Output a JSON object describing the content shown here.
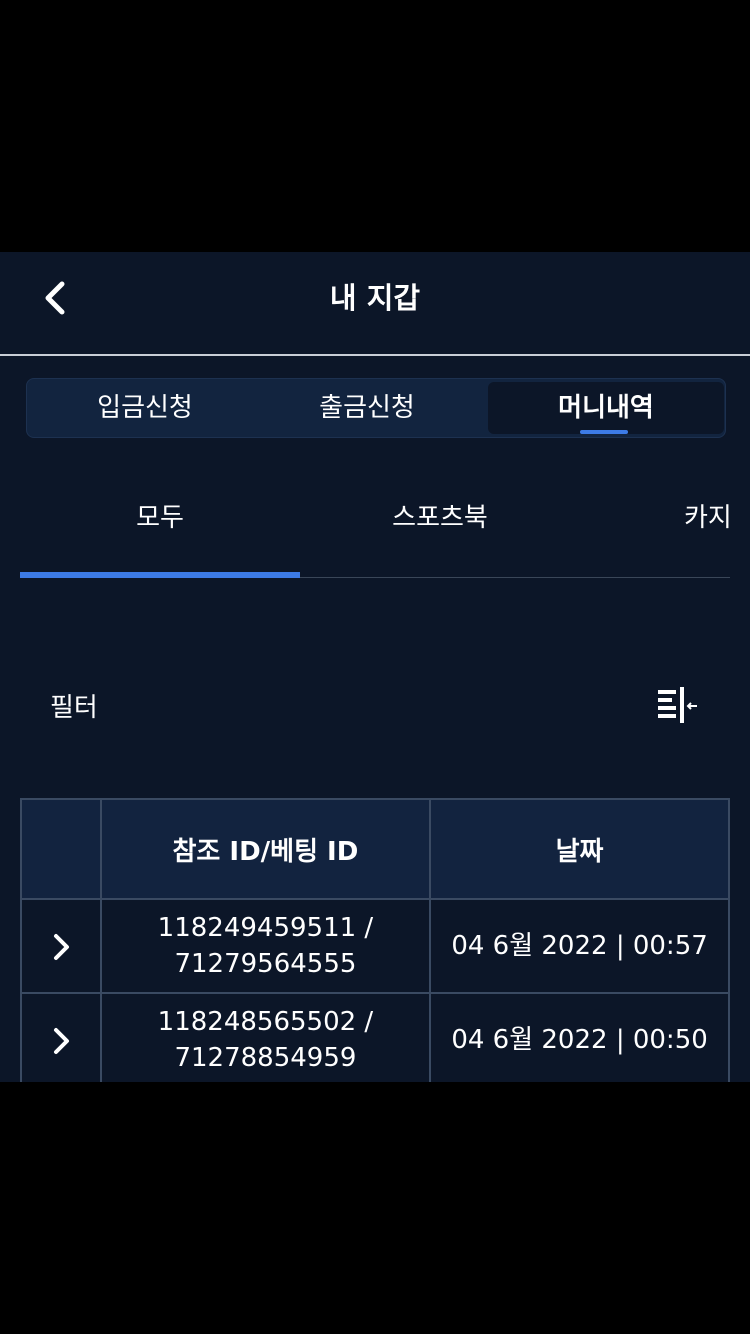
{
  "header": {
    "title": "내 지갑",
    "back_icon": "chevron-left-icon"
  },
  "segment": {
    "items": [
      {
        "label": "입금신청"
      },
      {
        "label": "출금신청"
      },
      {
        "label": "머니내역"
      }
    ],
    "active_index": 2
  },
  "subtabs": {
    "items": [
      {
        "label": "모두"
      },
      {
        "label": "스포츠북"
      },
      {
        "label": "카지"
      }
    ],
    "active_index": 0
  },
  "filter": {
    "label": "필터",
    "icon": "filter-toggle-icon"
  },
  "table": {
    "columns": [
      "",
      "참조 ID/베팅 ID",
      "날짜"
    ],
    "rows": [
      {
        "id_line1": "118249459511 /",
        "id_line2": "71279564555",
        "date": "04 6월 2022 | 00:57"
      },
      {
        "id_line1": "118248565502 /",
        "id_line2": "71278854959",
        "date": "04 6월 2022 | 00:50"
      }
    ]
  },
  "colors": {
    "background": "#0c1628",
    "panel": "#12233f",
    "accent": "#3d7be6",
    "border": "#3a4a62"
  }
}
